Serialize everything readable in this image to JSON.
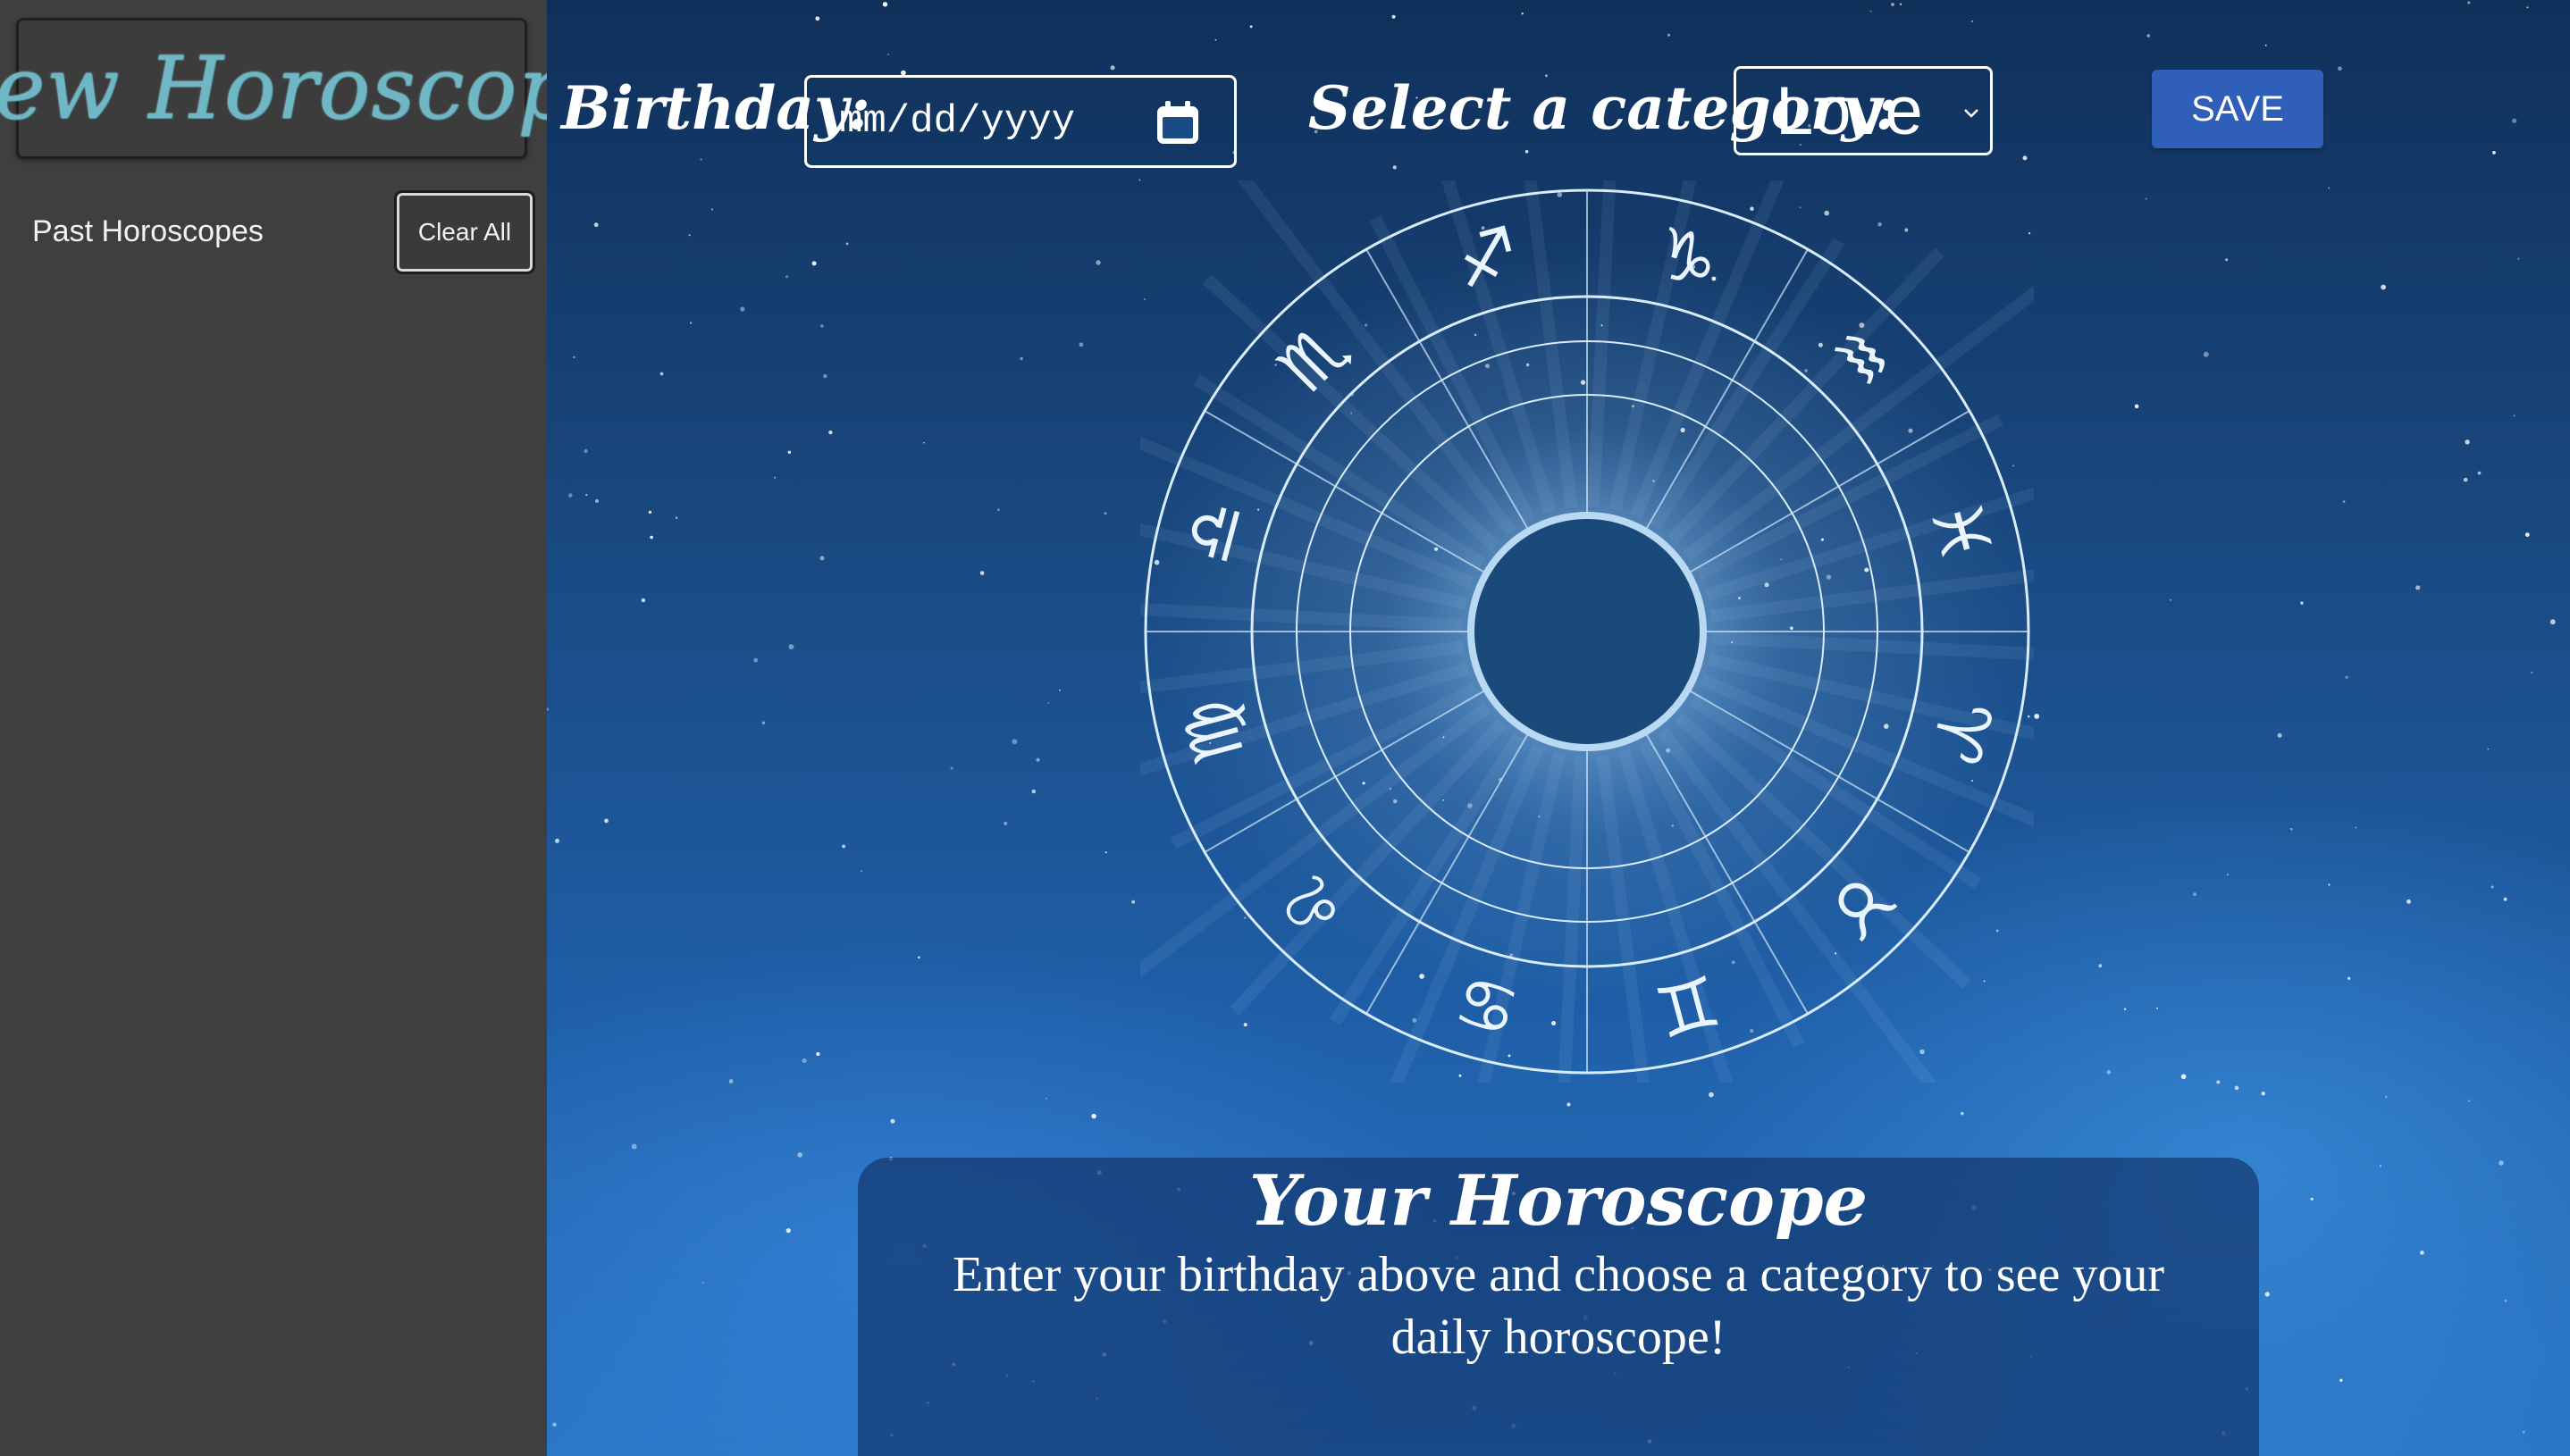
{
  "sidebar": {
    "logo": "New Horoscope",
    "history_label": "Past Horoscopes",
    "clear_button": "Clear All"
  },
  "toolbar": {
    "birthday_label": "Birthday:",
    "birthday_placeholder": "mm/dd/yyyy",
    "category_label": "Select a category:",
    "category_value": "Love",
    "save_button": "SAVE"
  },
  "wheel": {
    "signs": [
      "♐",
      "♑",
      "♒",
      "♓",
      "♈",
      "♉",
      "♊",
      "♋",
      "♌",
      "♍",
      "♎",
      "♏"
    ]
  },
  "card": {
    "title": "Your Horoscope",
    "text": "Enter your birthday above and choose a category to see your daily horoscope!"
  },
  "colors": {
    "sidebar_bg": "#3f3f3f",
    "save_button": "#2f5fb8",
    "sky": "#1a4b84"
  }
}
